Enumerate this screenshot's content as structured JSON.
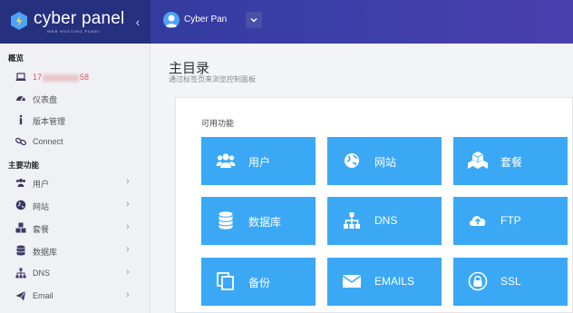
{
  "brand": {
    "name": "cyber panel",
    "sub": "WEB HOSTING PANEL"
  },
  "header": {
    "collapse_glyph": "‹",
    "user_name": "Cyber Pan",
    "dropdown_glyph": "⌄"
  },
  "sidebar": {
    "section_overview": "概览",
    "ip_prefix": "17",
    "ip_suffix": "58",
    "items_overview": [
      {
        "label": "仪表盘",
        "icon": "dashboard-icon"
      },
      {
        "label": "版本管理",
        "icon": "info-icon"
      },
      {
        "label": "Connect",
        "icon": "link-icon"
      }
    ],
    "section_main": "主要功能",
    "items_main": [
      {
        "label": "用户",
        "icon": "users-icon"
      },
      {
        "label": "网站",
        "icon": "globe-icon"
      },
      {
        "label": "套餐",
        "icon": "cubes-icon"
      },
      {
        "label": "数据库",
        "icon": "database-icon"
      },
      {
        "label": "DNS",
        "icon": "sitemap-icon"
      },
      {
        "label": "Email",
        "icon": "paper-plane-icon"
      }
    ],
    "arrow_glyph": "›"
  },
  "main": {
    "title": "主目录",
    "subtitle": "通过标签页来浏览控制面板",
    "card_label": "可用功能",
    "tiles": [
      {
        "label": "用户",
        "icon": "users-icon"
      },
      {
        "label": "网站",
        "icon": "globe-icon"
      },
      {
        "label": "套餐",
        "icon": "cubes-icon"
      },
      {
        "label": "数据库",
        "icon": "database-icon"
      },
      {
        "label": "DNS",
        "icon": "sitemap-icon"
      },
      {
        "label": "FTP",
        "icon": "cloud-upload-icon"
      },
      {
        "label": "备份",
        "icon": "copy-icon"
      },
      {
        "label": "EMAILS",
        "icon": "envelope-icon"
      },
      {
        "label": "SSL",
        "icon": "lock-icon"
      }
    ]
  },
  "colors": {
    "accent": "#3ba8f5",
    "topbar": "#2d3794",
    "alert": "#e0505a"
  }
}
